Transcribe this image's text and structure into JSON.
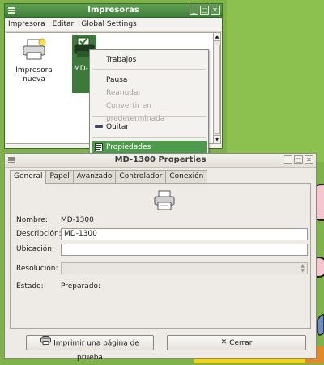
{
  "printers_window": {
    "title": "Impresoras",
    "menu": [
      "Impresora",
      "Editar",
      "Global Settings"
    ],
    "items": [
      {
        "label_line1": "Impresora",
        "label_line2": "nueva"
      },
      {
        "label": "MD-"
      }
    ]
  },
  "context_menu": {
    "items": [
      {
        "label": "Trabajos",
        "enabled": true
      },
      {
        "label": "Pausa",
        "enabled": true
      },
      {
        "label": "Reanudar",
        "enabled": false
      },
      {
        "label": "Convertir en predeterminada",
        "enabled": false
      },
      {
        "label": "Quitar",
        "enabled": true
      },
      {
        "label": "Propiedades",
        "enabled": true,
        "highlighted": true
      }
    ]
  },
  "properties_window": {
    "title": "MD-1300 Properties",
    "tabs": [
      "General",
      "Papel",
      "Avanzado",
      "Controlador",
      "Conexión"
    ],
    "active_tab": "General",
    "fields": {
      "nombre_label": "Nombre:",
      "nombre_value": "MD-1300",
      "descripcion_label": "Descripción:",
      "descripcion_value": "MD-1300",
      "ubicacion_label": "Ubicación:",
      "ubicacion_value": "",
      "resolucion_label": "Resolución:",
      "estado_label": "Estado:",
      "estado_value": "Preparado:"
    },
    "buttons": {
      "test_page": "Imprimir una página de prueba",
      "close": "Cerrar"
    }
  },
  "colors": {
    "title_green": "#4e9a4c",
    "desktop_green": "#7fb24a"
  }
}
